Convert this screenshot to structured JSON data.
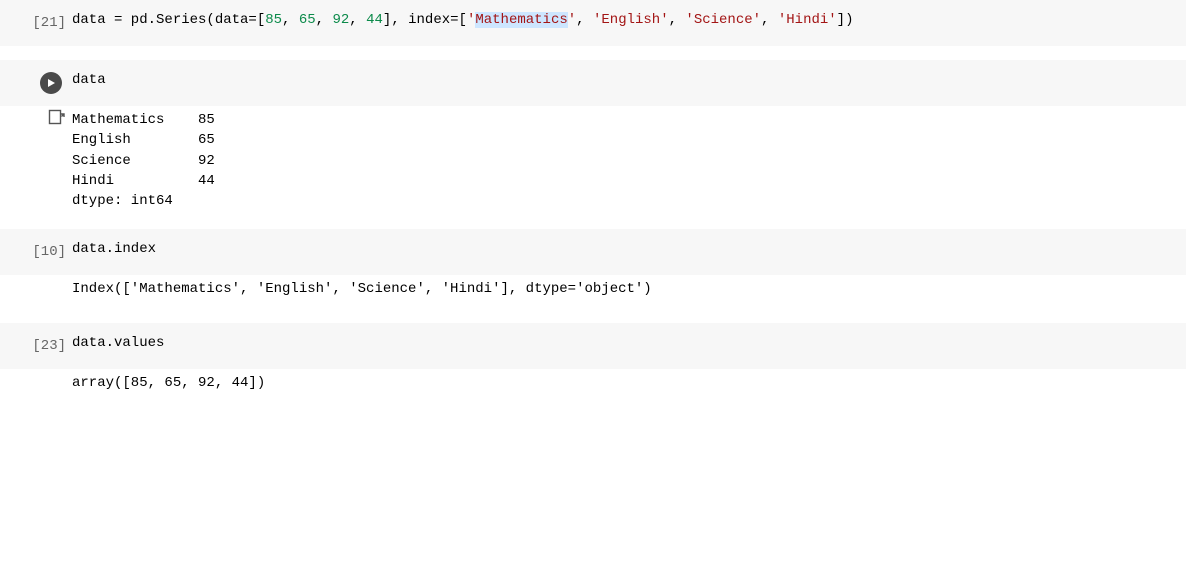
{
  "cells": [
    {
      "exec": "[21]",
      "code_html": "data = pd.Series(data=[<span class='num'>85</span>, <span class='num'>65</span>, <span class='num'>92</span>, <span class='num'>44</span>], index=[<span class='str'>'<span class='sel'>Mathematics</span>'</span>, <span class='str'>'English'</span>, <span class='str'>'Science'</span>, <span class='str'>'Hindi'</span>])"
    },
    {
      "play": true,
      "code_html": "data",
      "out_icon": true,
      "output": "Mathematics    85\nEnglish        65\nScience        92\nHindi          44\ndtype: int64"
    },
    {
      "exec": "[10]",
      "code_html": "data.index",
      "output": "Index(['Mathematics', 'English', 'Science', 'Hindi'], dtype='object')"
    },
    {
      "exec": "[23]",
      "code_html": "data.values",
      "output": "array([85, 65, 92, 44])"
    }
  ]
}
